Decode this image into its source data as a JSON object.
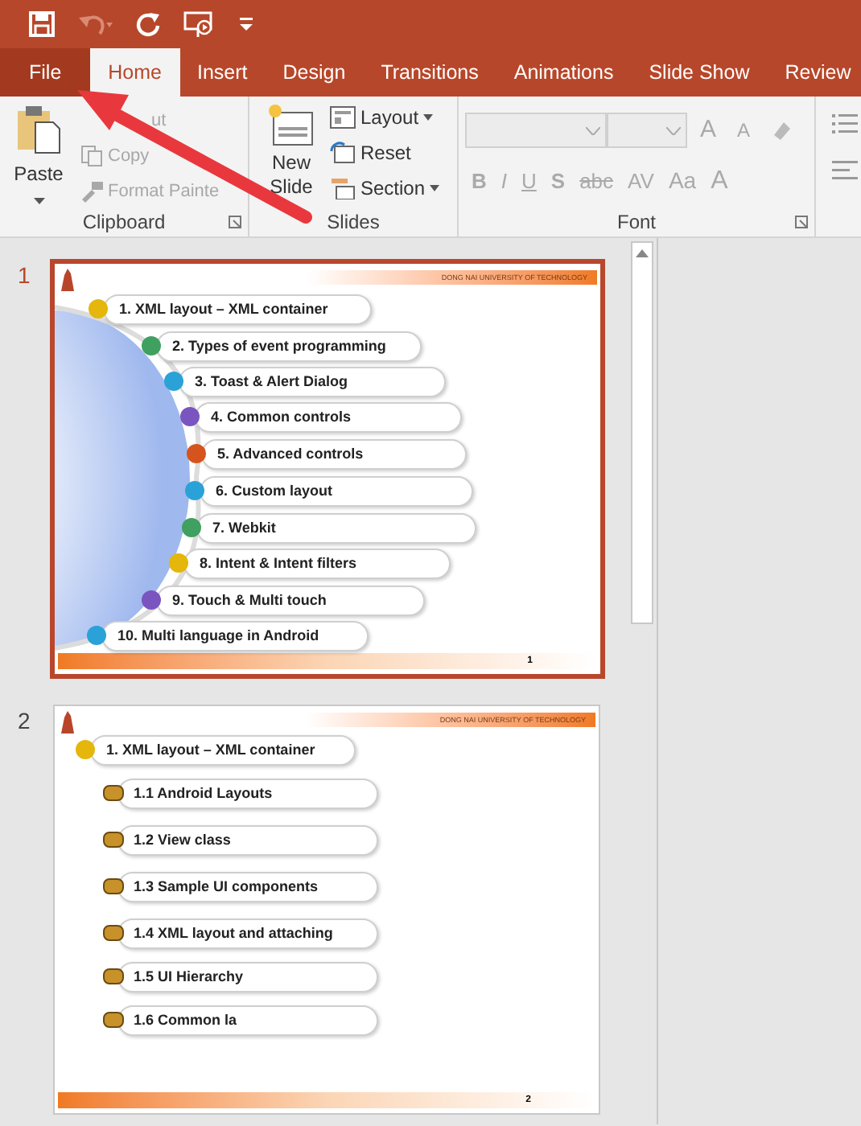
{
  "quick_access": [
    {
      "kind": "save",
      "disabled": false
    },
    {
      "kind": "undo",
      "disabled": true
    },
    {
      "kind": "redo",
      "disabled": false
    },
    {
      "kind": "present",
      "disabled": false
    },
    {
      "kind": "customize",
      "disabled": false
    }
  ],
  "tabs": [
    {
      "label": "File",
      "kind": "backstage",
      "selected": false
    },
    {
      "label": "Home",
      "kind": "tab",
      "selected": true
    },
    {
      "label": "Insert",
      "kind": "tab",
      "selected": false
    },
    {
      "label": "Design",
      "kind": "tab",
      "selected": false
    },
    {
      "label": "Transitions",
      "kind": "tab",
      "selected": false
    },
    {
      "label": "Animations",
      "kind": "tab",
      "selected": false
    },
    {
      "label": "Slide Show",
      "kind": "tab",
      "selected": false
    },
    {
      "label": "Review",
      "kind": "tab",
      "selected": false
    }
  ],
  "ribbon": {
    "clipboard": {
      "label": "Clipboard",
      "paste": "Paste",
      "commands": [
        {
          "label": "ut",
          "kind": "cut",
          "disabled": true
        },
        {
          "label": "Copy",
          "kind": "copy",
          "disabled": true
        },
        {
          "label": "Format Painte",
          "kind": "painter",
          "disabled": true
        }
      ]
    },
    "slides": {
      "label": "Slides",
      "new_slide": "New Slide",
      "commands": [
        {
          "label": "Layout",
          "kind": "layout",
          "dropdown": true
        },
        {
          "label": "Reset",
          "kind": "reset",
          "dropdown": false
        },
        {
          "label": "Section",
          "kind": "section",
          "dropdown": true
        }
      ]
    },
    "font": {
      "label": "Font",
      "row1": [
        {
          "text": "A",
          "kind": "grow"
        },
        {
          "text": "A",
          "kind": "shrink"
        }
      ],
      "row2": [
        {
          "text": "B",
          "kind": "bold"
        },
        {
          "text": "I",
          "kind": "italic"
        },
        {
          "text": "U",
          "kind": "underline"
        },
        {
          "text": "S",
          "kind": "shadow"
        },
        {
          "text": "abc",
          "kind": "strike"
        },
        {
          "text": "AV",
          "kind": "spacing"
        },
        {
          "text": "Aa",
          "kind": "case"
        },
        {
          "text": "A",
          "kind": "color"
        }
      ]
    }
  },
  "slides": [
    {
      "number": "1",
      "selected": true,
      "header": "DONG NAI UNIVERSITY OF TECHNOLOGY",
      "page": "1",
      "items": [
        {
          "text": "1. XML layout – XML container",
          "kind": "step",
          "color": "#e5b60b"
        },
        {
          "text": "2. Types of event programming",
          "kind": "step",
          "color": "#3fa060"
        },
        {
          "text": "3. Toast & Alert Dialog",
          "kind": "step",
          "color": "#2aa2d8"
        },
        {
          "text": "4. Common controls",
          "kind": "step",
          "color": "#7a55c0"
        },
        {
          "text": "5. Advanced controls",
          "kind": "step",
          "color": "#d5541e"
        },
        {
          "text": "6. Custom layout",
          "kind": "step",
          "color": "#2aa2d8"
        },
        {
          "text": "7. Webkit",
          "kind": "step",
          "color": "#3fa060"
        },
        {
          "text": "8. Intent & Intent filters",
          "kind": "step",
          "color": "#e5b60b"
        },
        {
          "text": "9. Touch & Multi touch",
          "kind": "step",
          "color": "#7a55c0"
        },
        {
          "text": "10. Multi language in Android",
          "kind": "step",
          "color": "#2aa2d8"
        }
      ]
    },
    {
      "number": "2",
      "selected": false,
      "header": "DONG NAI UNIVERSITY OF TECHNOLOGY",
      "page": "2",
      "items": [
        {
          "text": "1. XML layout – XML container",
          "kind": "topic",
          "color": "#e5b60b"
        },
        {
          "text": "1.1 Android Layouts",
          "kind": "subtopic",
          "color": "#c8922a"
        },
        {
          "text": "1.2 View class",
          "kind": "subtopic",
          "color": "#c8922a"
        },
        {
          "text": "1.3 Sample UI components",
          "kind": "subtopic",
          "color": "#c8922a"
        },
        {
          "text": "1.4 XML layout and attaching",
          "kind": "subtopic",
          "color": "#c8922a"
        },
        {
          "text": "1.5 UI Hierarchy",
          "kind": "subtopic",
          "color": "#c8922a"
        },
        {
          "text": "1.6 Common la",
          "kind": "subtopic",
          "color": "#c8922a"
        }
      ]
    }
  ]
}
